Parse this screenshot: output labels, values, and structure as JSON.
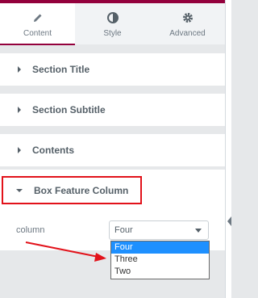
{
  "tabs": [
    {
      "label": "Content",
      "icon": "pencil-icon",
      "active": true
    },
    {
      "label": "Style",
      "icon": "half-circle-icon",
      "active": false
    },
    {
      "label": "Advanced",
      "icon": "gear-icon",
      "active": false
    }
  ],
  "sections": [
    {
      "title": "Section Title"
    },
    {
      "title": "Section Subtitle"
    },
    {
      "title": "Contents"
    }
  ],
  "open_section": {
    "title": "Box Feature Column",
    "control_label": "column",
    "select_value": "Four",
    "options": [
      "Four",
      "Three",
      "Two"
    ]
  },
  "colors": {
    "accent": "#93003c",
    "highlight_border": "#e2121a",
    "option_selected": "#1e90ff"
  }
}
